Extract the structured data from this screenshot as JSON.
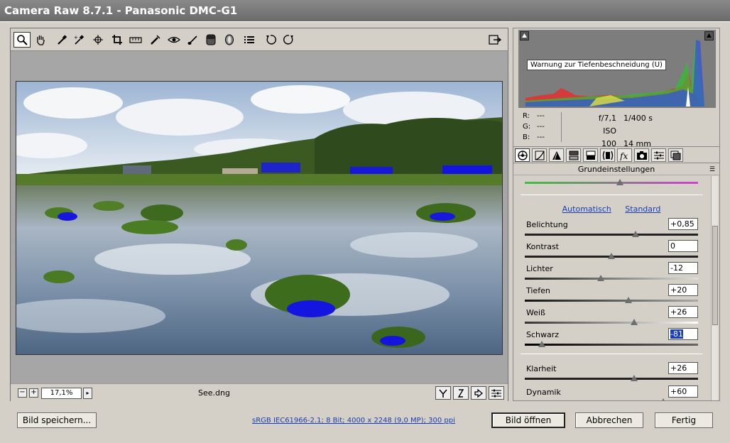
{
  "window": {
    "title": "Camera Raw 8.7.1 - Panasonic DMC-G1"
  },
  "status": {
    "zoom": "17,1%",
    "zoom_out": "−",
    "zoom_in": "+",
    "zoom_dropdown": "▸",
    "filename": "See.dng"
  },
  "histogram": {
    "tooltip": "Warnung zur Tiefenbeschneidung (U)",
    "r_label": "R:",
    "r": "---",
    "g_label": "G:",
    "g": "---",
    "b_label": "B:",
    "b": "---",
    "aperture": "f/7,1",
    "shutter": "1/400 s",
    "iso": "ISO 100",
    "focal": "14 mm"
  },
  "panel": {
    "title": "Grundeinstellungen",
    "menu": "☰",
    "auto": "Automatisch",
    "default": "Standard",
    "sliders": [
      {
        "label": "Belichtung",
        "value": "+0,85",
        "level": 0.64
      },
      {
        "label": "Kontrast",
        "value": "0",
        "level": 0.5
      },
      {
        "label": "Lichter",
        "value": "-12",
        "level": 0.44
      },
      {
        "label": "Tiefen",
        "value": "+20",
        "level": 0.6
      },
      {
        "label": "Weiß",
        "value": "+26",
        "level": 0.63
      },
      {
        "label": "Schwarz",
        "value": "-81",
        "level": 0.1
      },
      {
        "label": "Klarheit",
        "value": "+26",
        "level": 0.63
      },
      {
        "label": "Dynamik",
        "value": "+60",
        "level": 0.8
      }
    ],
    "top_slider_level": 0.55
  },
  "footer": {
    "save": "Bild speichern...",
    "specs": "sRGB IEC61966-2.1; 8 Bit; 4000 x 2248 (9,0 MP); 300 ppi",
    "open": "Bild öffnen",
    "cancel": "Abbrechen",
    "done": "Fertig"
  },
  "colors": {
    "accent": "#1a3eb3",
    "title_bar": "#7a7a7a",
    "window_bg": "#d4d0c8",
    "clip_warning": "#0000ff"
  }
}
